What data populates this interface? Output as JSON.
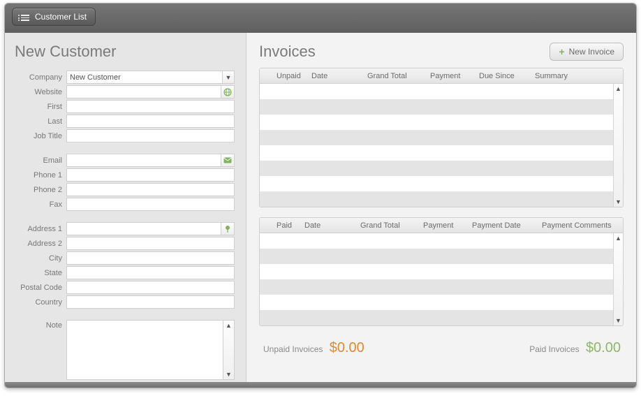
{
  "toolbar": {
    "customer_list_label": "Customer List"
  },
  "left": {
    "title": "New Customer",
    "fields": {
      "company_label": "Company",
      "company_value": "New Customer",
      "website_label": "Website",
      "website_value": "",
      "first_label": "First",
      "first_value": "",
      "last_label": "Last",
      "last_value": "",
      "job_title_label": "Job Title",
      "job_title_value": "",
      "email_label": "Email",
      "email_value": "",
      "phone1_label": "Phone 1",
      "phone1_value": "",
      "phone2_label": "Phone 2",
      "phone2_value": "",
      "fax_label": "Fax",
      "fax_value": "",
      "address1_label": "Address 1",
      "address1_value": "",
      "address2_label": "Address 2",
      "address2_value": "",
      "city_label": "City",
      "city_value": "",
      "state_label": "State",
      "state_value": "",
      "postal_label": "Postal Code",
      "postal_value": "",
      "country_label": "Country",
      "country_value": "",
      "note_label": "Note",
      "note_value": ""
    }
  },
  "right": {
    "title": "Invoices",
    "new_invoice_label": "New Invoice",
    "unpaid_grid": {
      "columns": [
        "Unpaid",
        "Date",
        "Grand Total",
        "Payment",
        "Due Since",
        "Summary"
      ],
      "rows": []
    },
    "paid_grid": {
      "columns": [
        "Paid",
        "Date",
        "Grand Total",
        "Payment",
        "Payment Date",
        "Payment Comments"
      ],
      "rows": []
    },
    "totals": {
      "unpaid_label": "Unpaid Invoices",
      "unpaid_amount": "$0.00",
      "paid_label": "Paid Invoices",
      "paid_amount": "$0.00"
    }
  },
  "col_widths": {
    "unpaid": [
      70,
      80,
      90,
      70,
      80,
      100
    ],
    "paid": [
      60,
      80,
      90,
      70,
      100,
      120
    ]
  }
}
